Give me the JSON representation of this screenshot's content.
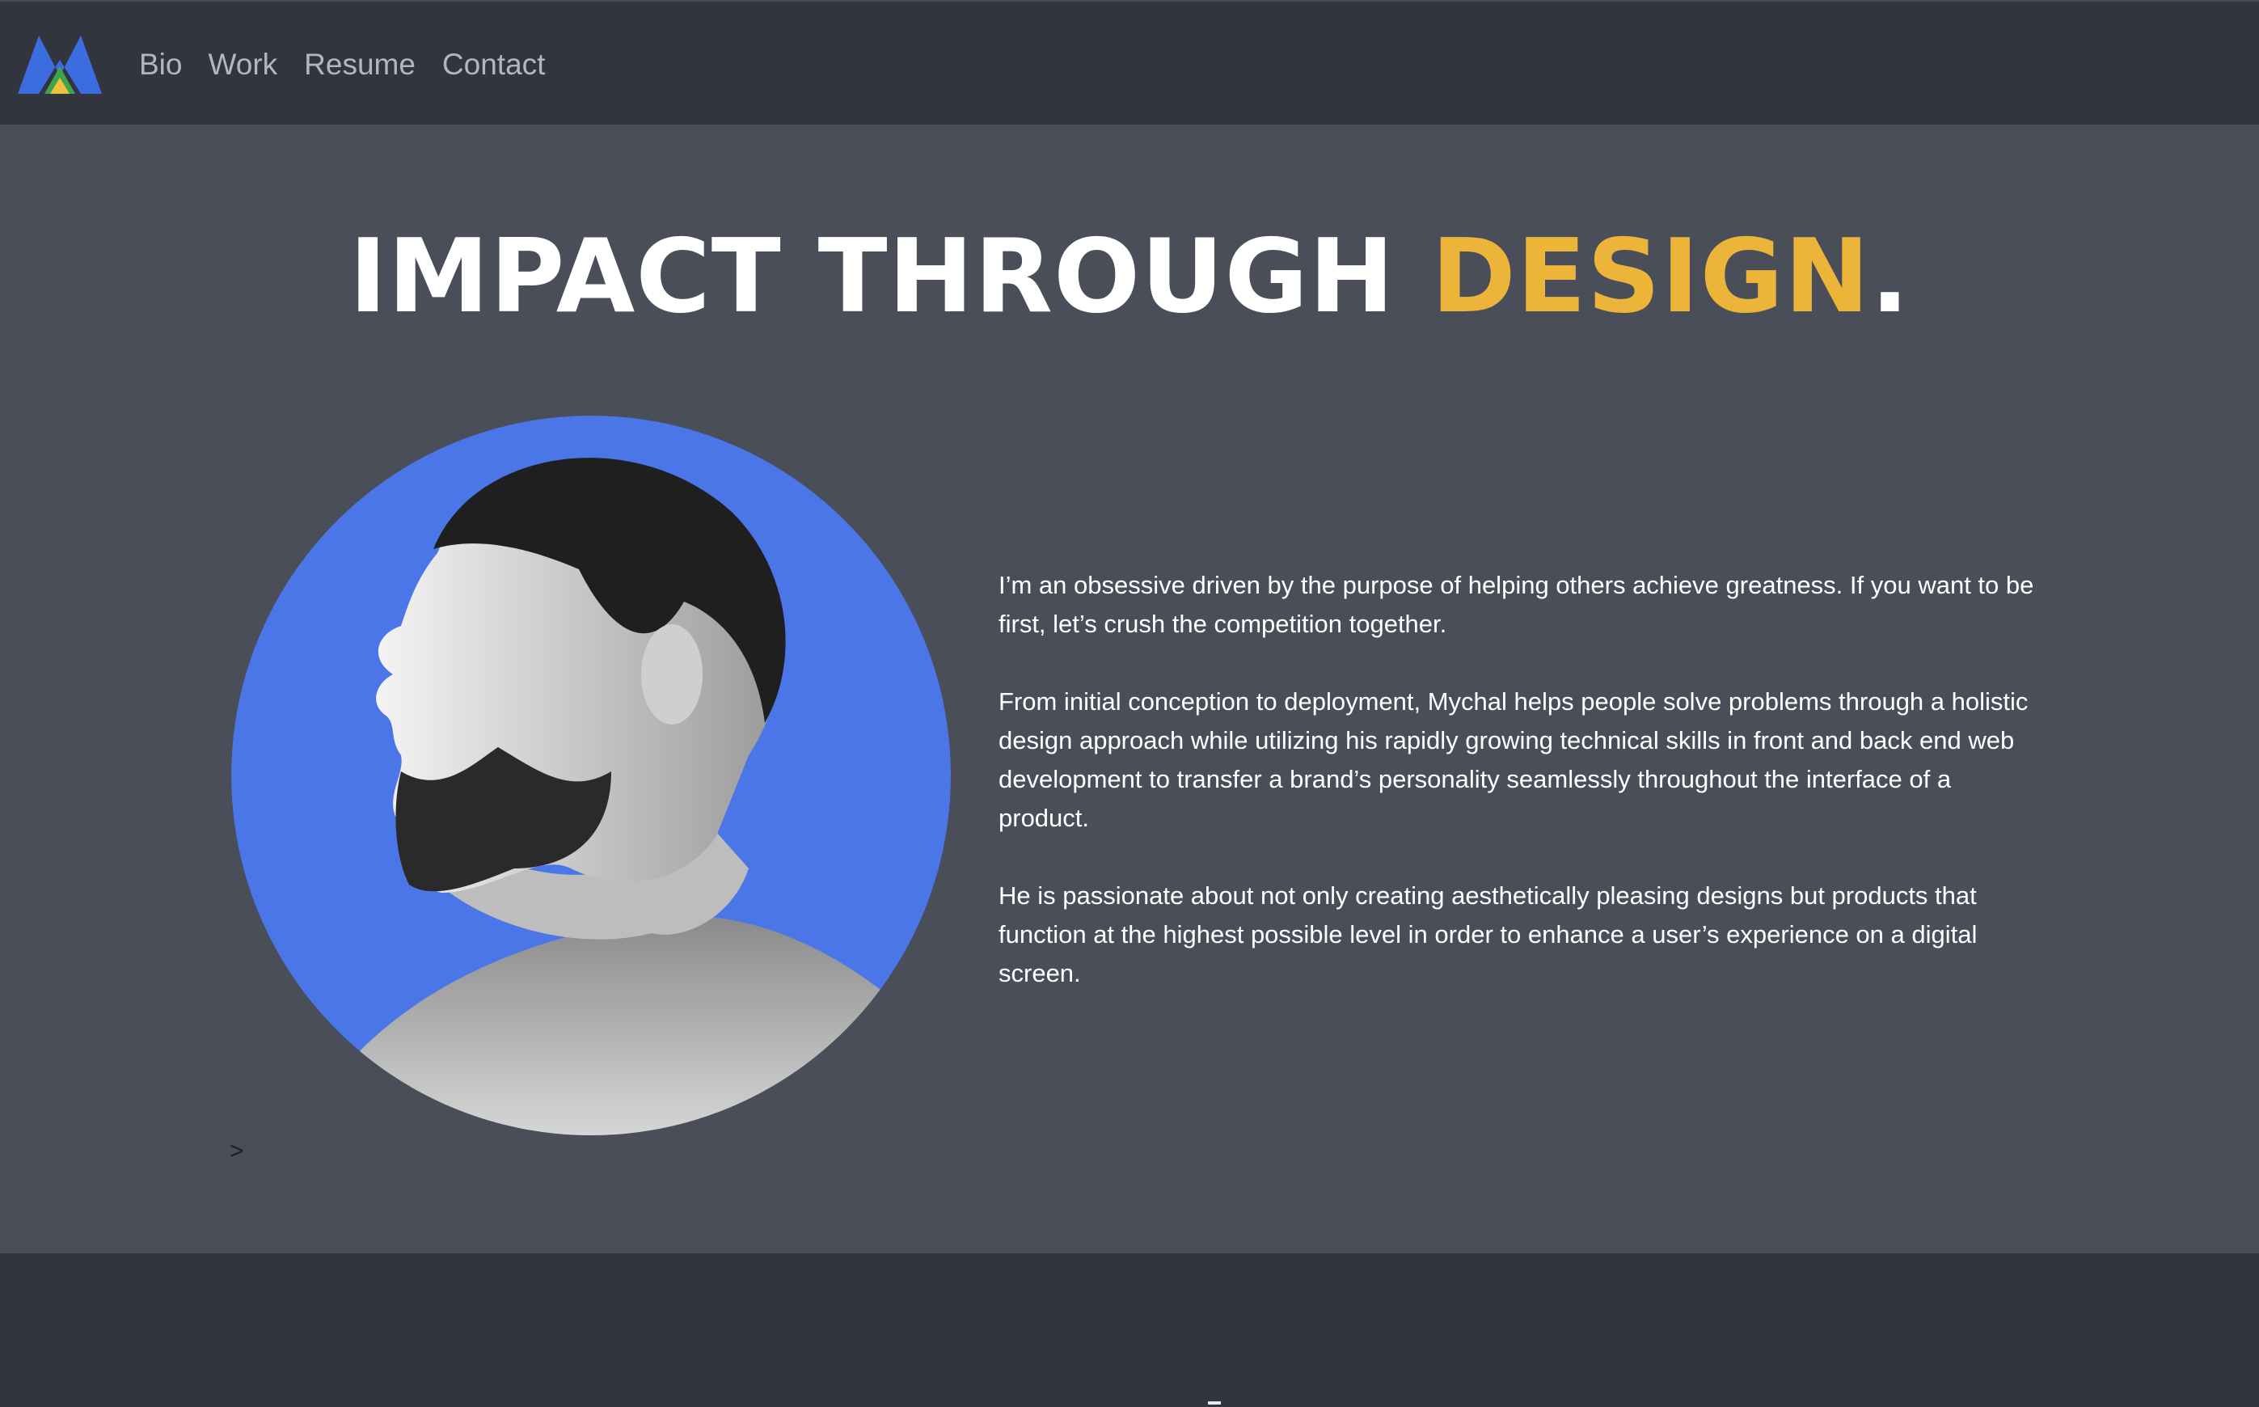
{
  "nav": {
    "logo_icon": "m-triangle-logo-icon",
    "items": [
      {
        "label": "Bio"
      },
      {
        "label": "Work"
      },
      {
        "label": "Resume"
      },
      {
        "label": "Contact"
      }
    ]
  },
  "hero": {
    "headline_main": "IMPACT THROUGH ",
    "headline_accent": "DESIGN",
    "headline_end": ".",
    "accent_color": "#ecb53a",
    "portrait_bg_color": "#4a76e8",
    "bio": {
      "paragraphs": [
        "I’m an obsessive driven by the purpose of helping others achieve greatness. If you want to be first, let’s crush the competition together.",
        "From initial conception to deployment, Mychal helps people solve problems through a holistic design approach while utilizing his rapidly growing technical skills in front and back end web development to transfer a brand’s personality seamlessly throughout the interface of a product.",
        "He is passionate about not only creating aesthetically pleasing designs but products that function at the highest possible level in order to enhance a user’s experience on a digital screen."
      ]
    },
    "next_arrow": ">"
  }
}
